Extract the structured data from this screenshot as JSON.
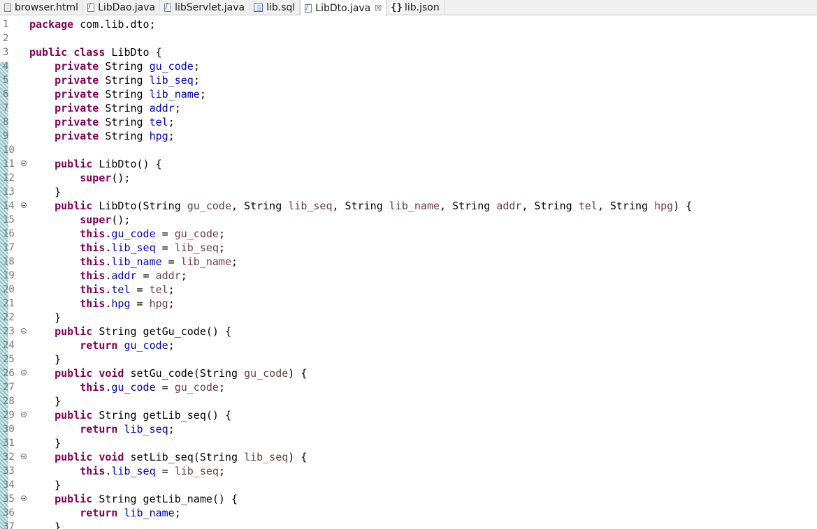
{
  "tabs": [
    {
      "id": "browser-html",
      "label": "browser.html",
      "icon": "html-file-icon",
      "active": false
    },
    {
      "id": "libdao-java",
      "label": "LibDao.java",
      "icon": "java-file-icon",
      "active": false
    },
    {
      "id": "libservlet-java",
      "label": "libServlet.java",
      "icon": "java-file-icon",
      "active": false
    },
    {
      "id": "lib-sql",
      "label": "lib.sql",
      "icon": "sql-file-icon",
      "active": false
    },
    {
      "id": "libdto-java",
      "label": "LibDto.java",
      "icon": "java-file-icon",
      "active": true,
      "close": "☒"
    },
    {
      "id": "lib-json",
      "label": "lib.json",
      "icon": "json-file-icon",
      "active": false
    }
  ],
  "colors": {
    "keyword": "#7f0055",
    "field": "#0000c0",
    "parameter": "#6a3e3e",
    "line_number": "#787878"
  },
  "code_lines": [
    {
      "n": "1",
      "text": "package com.lib.dto;"
    },
    {
      "n": "2",
      "text": ""
    },
    {
      "n": "3",
      "text": "public class LibDto {"
    },
    {
      "n": "4",
      "text": "    private String gu_code;"
    },
    {
      "n": "5",
      "text": "    private String lib_seq;"
    },
    {
      "n": "6",
      "text": "    private String lib_name;"
    },
    {
      "n": "7",
      "text": "    private String addr;"
    },
    {
      "n": "8",
      "text": "    private String tel;"
    },
    {
      "n": "9",
      "text": "    private String hpg;"
    },
    {
      "n": "10",
      "text": ""
    },
    {
      "n": "11",
      "text": "    public LibDto() {",
      "fold": true
    },
    {
      "n": "12",
      "text": "        super();"
    },
    {
      "n": "13",
      "text": "    }"
    },
    {
      "n": "14",
      "text": "    public LibDto(String gu_code, String lib_seq, String lib_name, String addr, String tel, String hpg) {",
      "fold": true
    },
    {
      "n": "15",
      "text": "        super();"
    },
    {
      "n": "16",
      "text": "        this.gu_code = gu_code;"
    },
    {
      "n": "17",
      "text": "        this.lib_seq = lib_seq;"
    },
    {
      "n": "18",
      "text": "        this.lib_name = lib_name;"
    },
    {
      "n": "19",
      "text": "        this.addr = addr;"
    },
    {
      "n": "20",
      "text": "        this.tel = tel;"
    },
    {
      "n": "21",
      "text": "        this.hpg = hpg;"
    },
    {
      "n": "22",
      "text": "    }"
    },
    {
      "n": "23",
      "text": "    public String getGu_code() {",
      "fold": true
    },
    {
      "n": "24",
      "text": "        return gu_code;"
    },
    {
      "n": "25",
      "text": "    }"
    },
    {
      "n": "26",
      "text": "    public void setGu_code(String gu_code) {",
      "fold": true
    },
    {
      "n": "27",
      "text": "        this.gu_code = gu_code;"
    },
    {
      "n": "28",
      "text": "    }"
    },
    {
      "n": "29",
      "text": "    public String getLib_seq() {",
      "fold": true
    },
    {
      "n": "30",
      "text": "        return lib_seq;"
    },
    {
      "n": "31",
      "text": "    }"
    },
    {
      "n": "32",
      "text": "    public void setLib_seq(String lib_seq) {",
      "fold": true
    },
    {
      "n": "33",
      "text": "        this.lib_seq = lib_seq;"
    },
    {
      "n": "34",
      "text": "    }"
    },
    {
      "n": "35",
      "text": "    public String getLib_name() {",
      "fold": true
    },
    {
      "n": "36",
      "text": "        return lib_name;"
    },
    {
      "n": "37",
      "text": "    }"
    }
  ]
}
